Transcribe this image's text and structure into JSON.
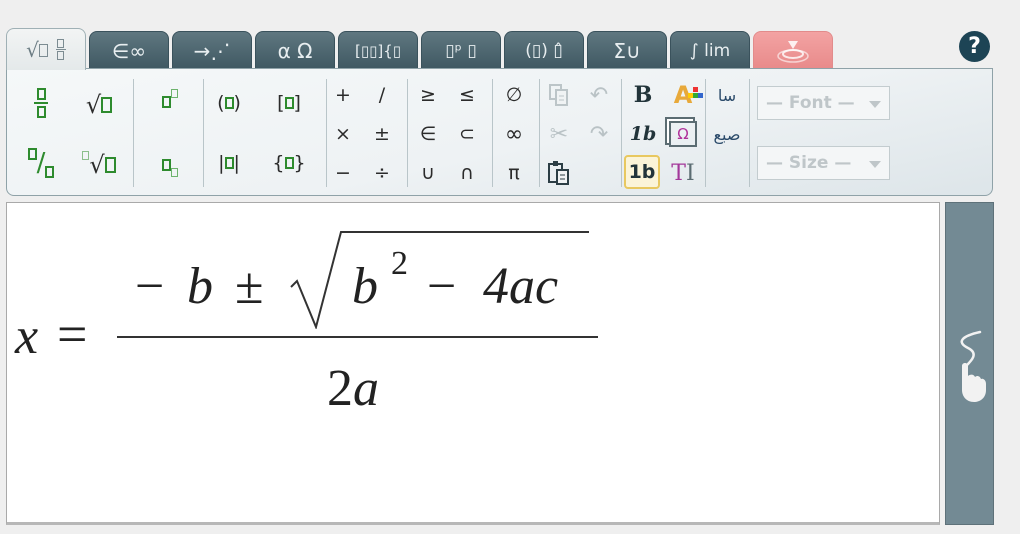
{
  "tabs": [
    {
      "id": "templates",
      "label": "√▯ ▯⁄▯",
      "active": true
    },
    {
      "id": "sets",
      "label": "∈∞"
    },
    {
      "id": "arrows",
      "label": "→⋰"
    },
    {
      "id": "greek",
      "label": "α Ω"
    },
    {
      "id": "matrices",
      "label": "[▯▯]{▯"
    },
    {
      "id": "scripts",
      "label": "▯ᵖ ▯"
    },
    {
      "id": "brackets",
      "label": "(▯) ▯̂"
    },
    {
      "id": "operators",
      "label": "Σ∪"
    },
    {
      "id": "calculus",
      "label": "∫ lim"
    },
    {
      "id": "handwriting",
      "label": "⊻"
    }
  ],
  "help_label": "?",
  "toolbar": {
    "templates": {
      "fraction": "fraction-template",
      "sqrt": "√",
      "superscript": "superscript",
      "parens": "( )",
      "brackets": "[ ]",
      "slash_fraction": "/",
      "nth_root": "√",
      "subscript": "subscript",
      "abs": "| |",
      "braces": "{ }"
    },
    "operators": [
      "+",
      "/",
      "×",
      "±",
      "−",
      "÷"
    ],
    "relations": [
      "≥",
      "≤",
      "∈",
      "⊂",
      "∪",
      "∩"
    ],
    "misc": [
      "∅",
      "∞",
      "π"
    ],
    "clipboard": {
      "copy": "copy",
      "undo": "↶",
      "cut": "✂",
      "redo": "↷",
      "paste": "paste"
    },
    "format": {
      "bold": "B",
      "color": "A",
      "italic": "1b",
      "special_chars": "Ω",
      "normal": "1b",
      "text": "T"
    },
    "rtl": {
      "rtl1": "ﺳﺎ",
      "rtl2": "ﺻﺒﻊ"
    },
    "font_dropdown": "— Font —",
    "size_dropdown": "— Size —"
  },
  "equation": {
    "lhs": "x",
    "equals": "=",
    "minus": "−",
    "b": "b",
    "pm": "±",
    "b2": "b",
    "exp": "2",
    "minus2": "−",
    "four_ac": "4ac",
    "den_two": "2",
    "den_a": "a"
  }
}
